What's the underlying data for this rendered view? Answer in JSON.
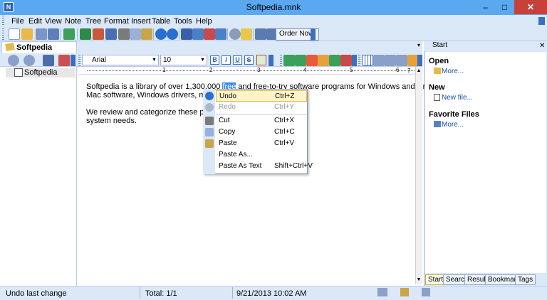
{
  "window": {
    "title": "Softpedia.mnk",
    "minimize": "–",
    "maximize": "□",
    "close": "✕"
  },
  "menu": [
    "File",
    "Edit",
    "View",
    "Note",
    "Tree",
    "Format",
    "Insert",
    "Table",
    "Tools",
    "Help"
  ],
  "toolbar": {
    "order_label": "Order Now!"
  },
  "tabs": {
    "left": "Softpedia"
  },
  "format": {
    "font": "Arial",
    "size": "10",
    "bold": "B",
    "italic": "I",
    "underline": "U",
    "strike": "S"
  },
  "tree": {
    "root": "Softpedia"
  },
  "ruler": {
    "marks": [
      "1",
      "2",
      "3",
      "4",
      "5",
      "6",
      "7"
    ]
  },
  "editor": {
    "line1a": "Softpedia is a library of over 1,300,000 ",
    "line1sel": "free",
    "line1b": " and free-to-try software programs for Windows and Unix/Linux, games,",
    "line2": "Mac software, Windows drivers, mobile de",
    "line3": "We review and categorize these products",
    "line4": "system needs."
  },
  "context_menu": [
    {
      "label": "Undo",
      "shortcut": "Ctrl+Z",
      "state": "hover"
    },
    {
      "label": "Redo",
      "shortcut": "Ctrl+Y",
      "state": "disabled"
    },
    {
      "label": "Cut",
      "shortcut": "Ctrl+X",
      "state": "normal"
    },
    {
      "label": "Copy",
      "shortcut": "Ctrl+C",
      "state": "normal"
    },
    {
      "label": "Paste",
      "shortcut": "Ctrl+V",
      "state": "normal"
    },
    {
      "label": "Paste As...",
      "shortcut": "",
      "state": "normal"
    },
    {
      "label": "Paste As Text",
      "shortcut": "Shift+Ctrl+V",
      "state": "normal"
    }
  ],
  "right_pane": {
    "header": "Start",
    "open_title": "Open",
    "open_link": "More...",
    "new_title": "New",
    "new_link": "New file...",
    "fav_title": "Favorite Files",
    "fav_link": "More...",
    "tabs": [
      "Start",
      "Search",
      "Result",
      "Bookmarks",
      "Tags"
    ]
  },
  "status": {
    "message": "Undo last change",
    "total": "Total: 1/1",
    "date": "9/21/2013 10:02 AM"
  },
  "colors": {
    "accent": "#5aa8f0",
    "chrome": "#dbe8f8",
    "selection": "#3b88e8",
    "menu_hover": "#fff3c8"
  }
}
